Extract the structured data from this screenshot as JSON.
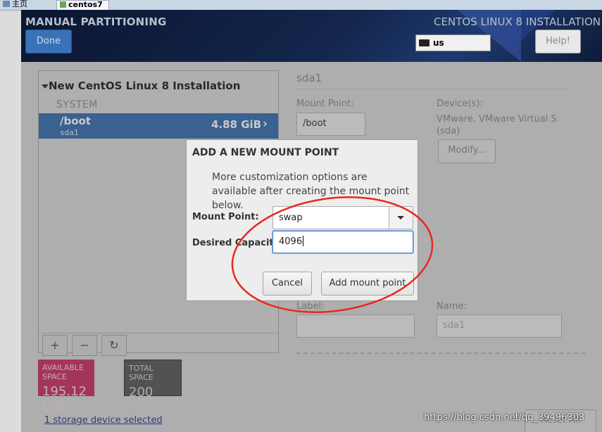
{
  "vmware_tabs": {
    "home": "主页",
    "vm": "centos7"
  },
  "header": {
    "title": "MANUAL PARTITIONING",
    "product": "CENTOS LINUX 8 INSTALLATION",
    "done_label": "Done",
    "keyboard_layout": "us",
    "help_label": "Help!"
  },
  "partitions": {
    "group_title": "New CentOS Linux 8 Installation",
    "section": "SYSTEM",
    "items": [
      {
        "mount": "/boot",
        "device": "sda1",
        "size": "4.88 GiB"
      }
    ],
    "toolbar": {
      "add": "+",
      "remove": "−",
      "refresh": "↻"
    }
  },
  "details": {
    "title": "sda1",
    "mount_point_label": "Mount Point:",
    "mount_point_value": "/boot",
    "devices_label": "Device(s):",
    "devices_value_1": "VMware, VMware Virtual S",
    "devices_value_2": "(sda)",
    "modify_label": "Modify...",
    "label_label": "Label:",
    "name_label": "Name:",
    "name_value": "sda1"
  },
  "space": {
    "available_label": "AVAILABLE SPACE",
    "available_value": "195.12 GiB",
    "total_label": "TOTAL SPACE",
    "total_value": "200 GiB"
  },
  "storage_link": "1 storage device selected",
  "reset_label": "Reset All",
  "dialog": {
    "title": "ADD A NEW MOUNT POINT",
    "description": "More customization options are available after creating the mount point below.",
    "mount_point_label": "Mount Point:",
    "mount_point_value": "swap",
    "capacity_label": "Desired Capacity:",
    "capacity_value": "4096",
    "cancel_label": "Cancel",
    "add_label": "Add mount point"
  },
  "watermark": "https://blog.csdn.net/qq_39496303",
  "colors": {
    "annotation": "#e8291f",
    "selection": "#3a6fb0",
    "available": "#cc3366"
  }
}
